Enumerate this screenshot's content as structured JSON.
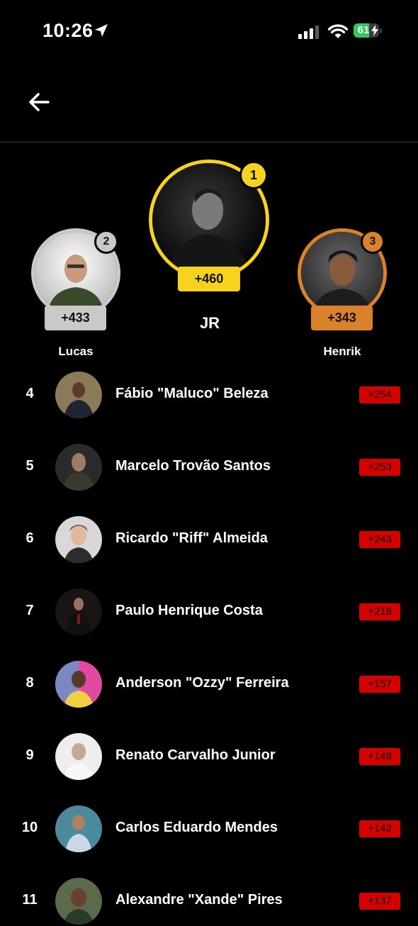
{
  "status_bar": {
    "time": "10:26",
    "battery_percent": "61",
    "battery_level": 0.61
  },
  "podium": [
    {
      "rank": "2",
      "name": "Lucas",
      "score": "+433",
      "color": "#c9c9c9"
    },
    {
      "rank": "1",
      "name": "JR",
      "score": "+460",
      "color": "#f7d21e"
    },
    {
      "rank": "3",
      "name": "Henrik",
      "score": "+343",
      "color": "#d9822b"
    }
  ],
  "leaderboard": [
    {
      "rank": "4",
      "name": "Fábio \"Maluco\" Beleza",
      "score": "+254"
    },
    {
      "rank": "5",
      "name": "Marcelo Trovão Santos",
      "score": "+253"
    },
    {
      "rank": "6",
      "name": "Ricardo \"Riff\" Almeida",
      "score": "+243"
    },
    {
      "rank": "7",
      "name": "Paulo Henrique Costa",
      "score": "+218"
    },
    {
      "rank": "8",
      "name": "Anderson \"Ozzy\" Ferreira",
      "score": "+157"
    },
    {
      "rank": "9",
      "name": "Renato Carvalho Junior",
      "score": "+148"
    },
    {
      "rank": "10",
      "name": "Carlos Eduardo Mendes",
      "score": "+142"
    },
    {
      "rank": "11",
      "name": "Alexandre \"Xande\" Pires",
      "score": "+137"
    }
  ],
  "colors": {
    "accent_red": "#d50000",
    "gold": "#f7d21e",
    "silver": "#c9c9c9",
    "bronze": "#d9822b"
  }
}
